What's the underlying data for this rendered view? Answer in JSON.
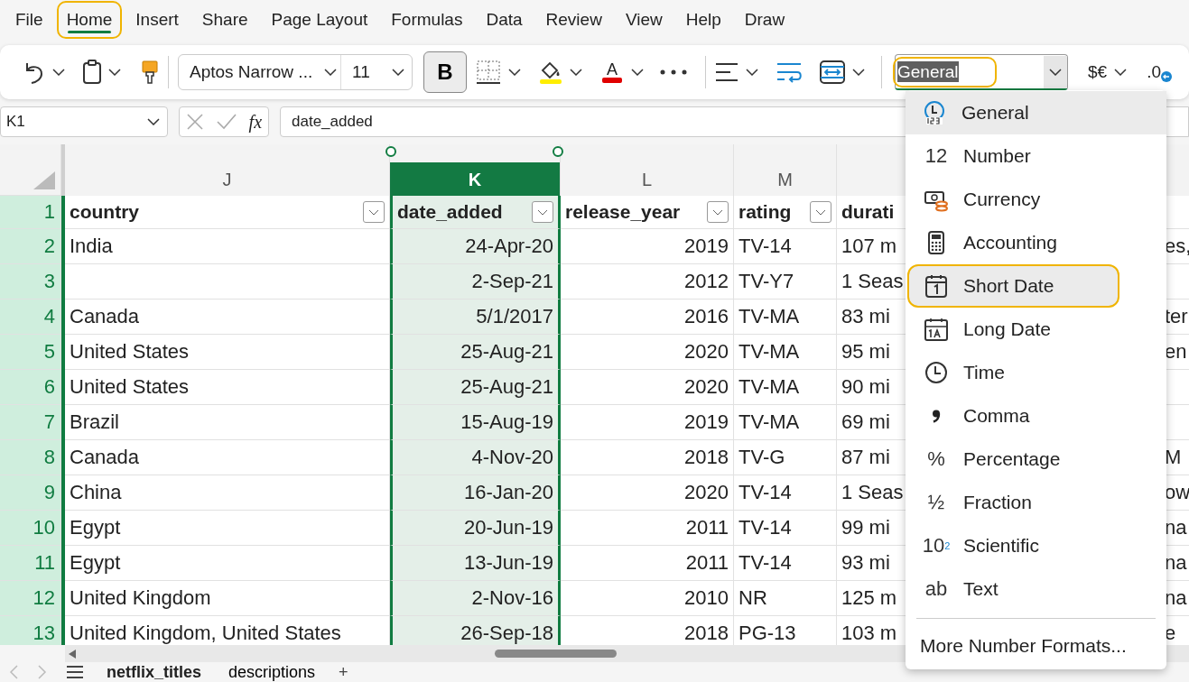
{
  "menu_tabs": [
    {
      "label": "File",
      "selected": false,
      "outlined": false
    },
    {
      "label": "Home",
      "selected": true,
      "outlined": true
    },
    {
      "label": "Insert",
      "selected": false,
      "outlined": false
    },
    {
      "label": "Share",
      "selected": false,
      "outlined": false
    },
    {
      "label": "Page Layout",
      "selected": false,
      "outlined": false
    },
    {
      "label": "Formulas",
      "selected": false,
      "outlined": false
    },
    {
      "label": "Data",
      "selected": false,
      "outlined": false
    },
    {
      "label": "Review",
      "selected": false,
      "outlined": false
    },
    {
      "label": "View",
      "selected": false,
      "outlined": false
    },
    {
      "label": "Help",
      "selected": false,
      "outlined": false
    },
    {
      "label": "Draw",
      "selected": false,
      "outlined": false
    }
  ],
  "ribbon": {
    "font": "Aptos Narrow ...",
    "size": "11",
    "bold": {
      "label": "B",
      "on": true
    },
    "font_color_glyph": "A",
    "number_format": {
      "value": "General",
      "outlined": true
    },
    "currency": "$€",
    "decimal": ".0"
  },
  "formula_bar": {
    "name_box": "K1",
    "function_label": "fx",
    "formula": "date_added"
  },
  "sheet": {
    "columns": [
      {
        "letter": "J",
        "heading": "country",
        "filter": true,
        "kind": "text",
        "selected": false
      },
      {
        "letter": "K",
        "heading": "date_added",
        "filter": true,
        "kind": "number",
        "selected": true
      },
      {
        "letter": "L",
        "heading": "release_year",
        "filter": true,
        "kind": "number",
        "selected": false
      },
      {
        "letter": "M",
        "heading": "rating",
        "filter": true,
        "kind": "text",
        "selected": false
      },
      {
        "heading": "durati",
        "filter": false,
        "kind": "text",
        "selected": false
      },
      {
        "kind": "text",
        "filter": false,
        "selected": false
      }
    ],
    "header_row": "1",
    "rows": [
      {
        "number": "2",
        "cells": [
          "India",
          "24-Apr-20",
          "2019",
          "TV-14",
          "107 m",
          "es,"
        ]
      },
      {
        "number": "3",
        "cells": [
          null,
          "2-Sep-21",
          "2012",
          "TV-Y7",
          "1 Seas",
          null
        ]
      },
      {
        "number": "4",
        "cells": [
          "Canada",
          "5/1/2017",
          "2016",
          "TV-MA",
          "83 mi",
          "ter"
        ]
      },
      {
        "number": "5",
        "cells": [
          "United States",
          "25-Aug-21",
          "2020",
          "TV-MA",
          "95 mi",
          "en"
        ]
      },
      {
        "number": "6",
        "cells": [
          "United States",
          "25-Aug-21",
          "2020",
          "TV-MA",
          "90 mi",
          null
        ]
      },
      {
        "number": "7",
        "cells": [
          "Brazil",
          "15-Aug-19",
          "2019",
          "TV-MA",
          "69 mi",
          null
        ]
      },
      {
        "number": "8",
        "cells": [
          "Canada",
          "4-Nov-20",
          "2018",
          "TV-G",
          "87 mi",
          "M"
        ]
      },
      {
        "number": "9",
        "cells": [
          "China",
          "16-Jan-20",
          "2020",
          "TV-14",
          "1 Seas",
          "ow"
        ]
      },
      {
        "number": "10",
        "cells": [
          "Egypt",
          "20-Jun-19",
          "2011",
          "TV-14",
          "99 mi",
          "na"
        ]
      },
      {
        "number": "11",
        "cells": [
          "Egypt",
          "13-Jun-19",
          "2011",
          "TV-14",
          "93 mi",
          "na"
        ]
      },
      {
        "number": "12",
        "cells": [
          "United Kingdom",
          "2-Nov-16",
          "2010",
          "NR",
          "125 m",
          "na"
        ]
      },
      {
        "number": "13",
        "cells": [
          "United Kingdom, United States",
          "26-Sep-18",
          "2018",
          "PG-13",
          "103 m",
          "e"
        ]
      }
    ]
  },
  "number_menu": {
    "items": [
      {
        "label": "General",
        "kind": "general",
        "selected": true,
        "outlined": false
      },
      {
        "label": "Number",
        "kind": "glyph",
        "icon": "12",
        "selected": false,
        "outlined": false
      },
      {
        "label": "Currency",
        "kind": "currency",
        "selected": false,
        "outlined": false
      },
      {
        "label": "Accounting",
        "kind": "accounting",
        "selected": false,
        "outlined": false
      },
      {
        "label": "Short Date",
        "kind": "short_date",
        "selected": false,
        "outlined": true
      },
      {
        "label": "Long Date",
        "kind": "long_date",
        "selected": false,
        "outlined": false
      },
      {
        "label": "Time",
        "kind": "time",
        "selected": false,
        "outlined": false
      },
      {
        "label": "Comma",
        "kind": "comma",
        "selected": false,
        "outlined": false
      },
      {
        "label": "Percentage",
        "kind": "glyph",
        "icon": "%",
        "selected": false,
        "outlined": false
      },
      {
        "label": "Fraction",
        "kind": "glyph",
        "icon": "½",
        "selected": false,
        "outlined": false
      },
      {
        "label": "Scientific",
        "kind": "glyph",
        "icon": "10$^{2}$",
        "selected": false,
        "outlined": false
      },
      {
        "label": "Text",
        "kind": "glyph",
        "icon": "ab",
        "selected": false,
        "outlined": false
      }
    ],
    "more": "More Number Formats..."
  },
  "sheet_tabs": [
    {
      "label": "netflix_titles",
      "selected": true
    },
    {
      "label": "descriptions",
      "selected": false
    }
  ],
  "add_sheet": "+"
}
